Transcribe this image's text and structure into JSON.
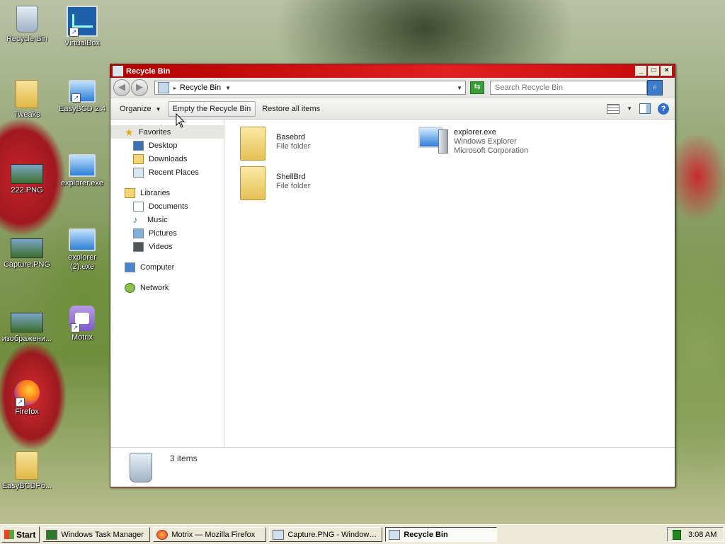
{
  "desktop": {
    "icons": [
      {
        "label": "Recycle Bin"
      },
      {
        "label": "VirtualBox"
      },
      {
        "label": "Tweaks"
      },
      {
        "label": "EasyBCD 2.4"
      },
      {
        "label": "222.PNG"
      },
      {
        "label": "explorer.exe"
      },
      {
        "label": "Capture.PNG"
      },
      {
        "label": "explorer (2).exe"
      },
      {
        "label": "изображени..."
      },
      {
        "label": "Motrix"
      },
      {
        "label": "Firefox"
      },
      {
        "label": "EasyBCDPo..."
      }
    ]
  },
  "window": {
    "title": "Recycle Bin",
    "address": {
      "path": "Recycle Bin",
      "separator": "▸"
    },
    "search": {
      "placeholder": "Search Recycle Bin"
    },
    "commands": {
      "organize": "Organize",
      "empty": "Empty the Recycle Bin",
      "restore": "Restore all items"
    },
    "nav": {
      "favorites": "Favorites",
      "desktop": "Desktop",
      "downloads": "Downloads",
      "recent": "Recent Places",
      "libraries": "Libraries",
      "documents": "Documents",
      "music": "Music",
      "pictures": "Pictures",
      "videos": "Videos",
      "computer": "Computer",
      "network": "Network"
    },
    "items": [
      {
        "name": "Basebrd",
        "type": "File folder"
      },
      {
        "name": "ShellBrd",
        "type": "File folder"
      },
      {
        "name": "explorer.exe",
        "desc": "Windows Explorer",
        "company": "Microsoft Corporation"
      }
    ],
    "status": {
      "count": "3 items"
    }
  },
  "taskbar": {
    "start": "Start",
    "tasks": [
      {
        "label": "Windows Task Manager"
      },
      {
        "label": "Motrix — Mozilla Firefox"
      },
      {
        "label": "Capture.PNG - Windows ..."
      },
      {
        "label": "Recycle Bin"
      }
    ],
    "clock": "3:08 AM"
  }
}
